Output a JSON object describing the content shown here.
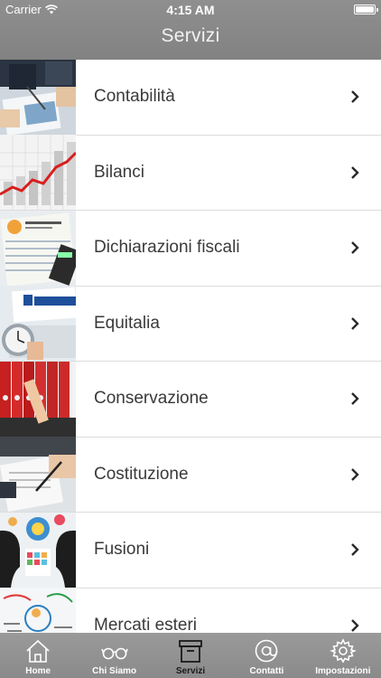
{
  "status_bar": {
    "carrier": "Carrier",
    "time": "4:15 AM"
  },
  "nav": {
    "title": "Servizi"
  },
  "services": [
    {
      "label": "Contabilità",
      "icon": "accounting-photo"
    },
    {
      "label": "Bilanci",
      "icon": "bar-chart-photo"
    },
    {
      "label": "Dichiarazioni fiscali",
      "icon": "tax-form-photo"
    },
    {
      "label": "Equitalia",
      "icon": "equitalia-photo"
    },
    {
      "label": "Conservazione",
      "icon": "binders-photo"
    },
    {
      "label": "Costituzione",
      "icon": "signing-photo"
    },
    {
      "label": "Fusioni",
      "icon": "heads-photo"
    },
    {
      "label": "Mercati esteri",
      "icon": "marketing-photo"
    }
  ],
  "tabs": [
    {
      "label": "Home",
      "icon": "home-icon"
    },
    {
      "label": "Chi Siamo",
      "icon": "glasses-icon"
    },
    {
      "label": "Servizi",
      "icon": "archive-box-icon",
      "active": true
    },
    {
      "label": "Contatti",
      "icon": "at-sign-icon"
    },
    {
      "label": "Impostazioni",
      "icon": "gear-icon"
    }
  ],
  "colors": {
    "bar": "#888888",
    "active_tab_label": "#1a1a1a",
    "tab_label": "#ffffff"
  }
}
